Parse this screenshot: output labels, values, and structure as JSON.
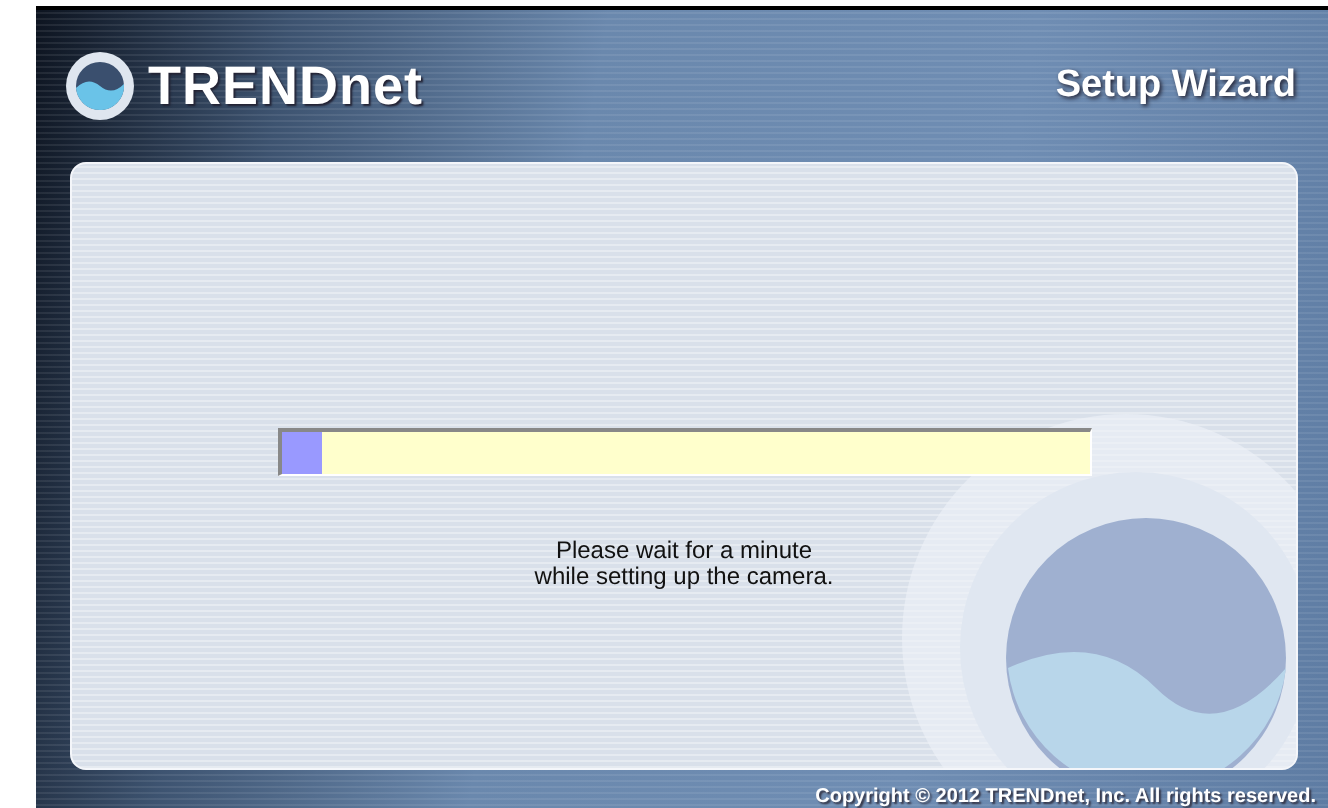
{
  "header": {
    "brand": "TRENDnet",
    "title": "Setup Wizard"
  },
  "progress": {
    "level": 0.05
  },
  "message": [
    "Please wait for a minute",
    "while setting up the camera."
  ],
  "footer": {
    "copyright": "Copyright © 2012 TRENDnet, Inc. All rights reserved."
  }
}
